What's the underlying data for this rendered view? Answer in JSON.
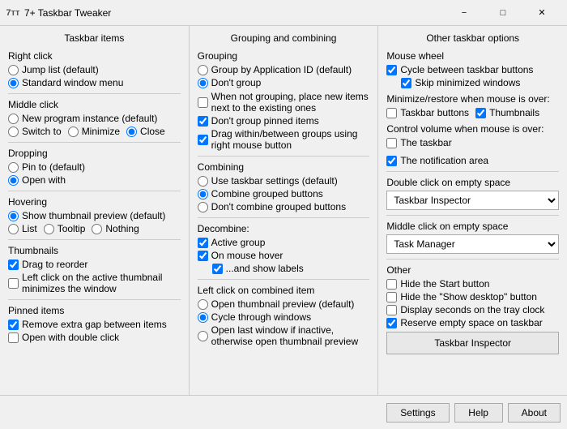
{
  "window": {
    "title": "7+ Taskbar Tweaker",
    "icon": "7tt"
  },
  "columns": {
    "col1": {
      "header": "Taskbar items",
      "sections": {
        "right_click": {
          "label": "Right click",
          "options": [
            {
              "id": "rc1",
              "label": "Jump list (default)",
              "checked": false
            },
            {
              "id": "rc2",
              "label": "Standard window menu",
              "checked": true
            }
          ]
        },
        "middle_click": {
          "label": "Middle click",
          "options": [
            {
              "id": "mc1",
              "label": "New program instance (default)",
              "checked": false
            }
          ],
          "inline": [
            {
              "id": "mc2",
              "label": "Switch to",
              "checked": false
            },
            {
              "id": "mc3",
              "label": "Minimize",
              "checked": false
            },
            {
              "id": "mc4",
              "label": "Close",
              "checked": true
            }
          ]
        },
        "dropping": {
          "label": "Dropping",
          "options": [
            {
              "id": "dp1",
              "label": "Pin to (default)",
              "checked": false
            },
            {
              "id": "dp2",
              "label": "Open with",
              "checked": true
            }
          ]
        },
        "hovering": {
          "label": "Hovering",
          "options": [
            {
              "id": "hv1",
              "label": "Show thumbnail preview (default)",
              "checked": true
            }
          ],
          "inline": [
            {
              "id": "hv2",
              "label": "List",
              "checked": false
            },
            {
              "id": "hv3",
              "label": "Tooltip",
              "checked": false
            },
            {
              "id": "hv4",
              "label": "Nothing",
              "checked": false
            }
          ]
        },
        "thumbnails": {
          "label": "Thumbnails",
          "checks": [
            {
              "id": "th1",
              "label": "Drag to reorder",
              "checked": true
            },
            {
              "id": "th2",
              "label": "Left click on the active thumbnail minimizes the window",
              "checked": false
            }
          ]
        },
        "pinned_items": {
          "label": "Pinned items",
          "checks": [
            {
              "id": "pi1",
              "label": "Remove extra gap between items",
              "checked": true
            },
            {
              "id": "pi2",
              "label": "Open with double click",
              "checked": false
            }
          ]
        }
      }
    },
    "col2": {
      "header": "Grouping and combining",
      "sections": {
        "grouping": {
          "label": "Grouping",
          "options": [
            {
              "id": "gr1",
              "label": "Group by Application ID (default)",
              "checked": false
            },
            {
              "id": "gr2",
              "label": "Don't group",
              "checked": true
            }
          ],
          "checks": [
            {
              "id": "gr3",
              "label": "When not grouping, place new items next to the existing ones",
              "checked": false
            },
            {
              "id": "gr4",
              "label": "Don't group pinned items",
              "checked": true
            },
            {
              "id": "gr5",
              "label": "Drag within/between groups using right mouse button",
              "checked": true
            }
          ]
        },
        "combining": {
          "label": "Combining",
          "options": [
            {
              "id": "co1",
              "label": "Use taskbar settings (default)",
              "checked": false
            },
            {
              "id": "co2",
              "label": "Combine grouped buttons",
              "checked": true
            },
            {
              "id": "co3",
              "label": "Don't combine grouped buttons",
              "checked": false
            }
          ]
        },
        "decombine": {
          "label": "Decombine:",
          "checks": [
            {
              "id": "dc1",
              "label": "Active group",
              "checked": true
            },
            {
              "id": "dc2",
              "label": "On mouse hover",
              "checked": true
            },
            {
              "id": "dc3",
              "label": "...and show labels",
              "checked": true,
              "indent": true
            }
          ]
        },
        "left_click": {
          "label": "Left click on combined item",
          "options": [
            {
              "id": "lc1",
              "label": "Open thumbnail preview (default)",
              "checked": false
            },
            {
              "id": "lc2",
              "label": "Cycle through windows",
              "checked": true
            },
            {
              "id": "lc3",
              "label": "Open last window if inactive, otherwise open thumbnail preview",
              "checked": false
            }
          ]
        }
      }
    },
    "col3": {
      "header": "Other taskbar options",
      "sections": {
        "mouse_wheel": {
          "label": "Mouse wheel",
          "checks": [
            {
              "id": "mw1",
              "label": "Cycle between taskbar buttons",
              "checked": true
            },
            {
              "id": "mw2",
              "label": "Skip minimized windows",
              "checked": true,
              "indent": true
            }
          ]
        },
        "minimize_restore": {
          "label": "Minimize/restore when mouse is over:",
          "inline": [
            {
              "id": "mr1",
              "label": "Taskbar buttons",
              "checked": false
            },
            {
              "id": "mr2",
              "label": "Thumbnails",
              "checked": true
            }
          ]
        },
        "control_volume": {
          "label": "Control volume when mouse is over:",
          "inline": [
            {
              "id": "cv1",
              "label": "The taskbar",
              "checked": false
            },
            {
              "id": "cv2",
              "label": "The notification area",
              "checked": true
            }
          ]
        },
        "double_click": {
          "label": "Double click on empty space",
          "dropdown": "Taskbar Inspector"
        },
        "middle_click_empty": {
          "label": "Middle click on empty space",
          "dropdown": "Task Manager"
        },
        "other": {
          "label": "Other",
          "checks": [
            {
              "id": "ot1",
              "label": "Hide the Start button",
              "checked": false
            },
            {
              "id": "ot2",
              "label": "Hide the \"Show desktop\" button",
              "checked": false
            },
            {
              "id": "ot3",
              "label": "Display seconds on the tray clock",
              "checked": false
            },
            {
              "id": "ot4",
              "label": "Reserve empty space on taskbar",
              "checked": true
            }
          ]
        },
        "taskbar_inspector_btn": "Taskbar Inspector"
      }
    }
  },
  "buttons": {
    "settings": "Settings",
    "help": "Help",
    "about": "About"
  }
}
